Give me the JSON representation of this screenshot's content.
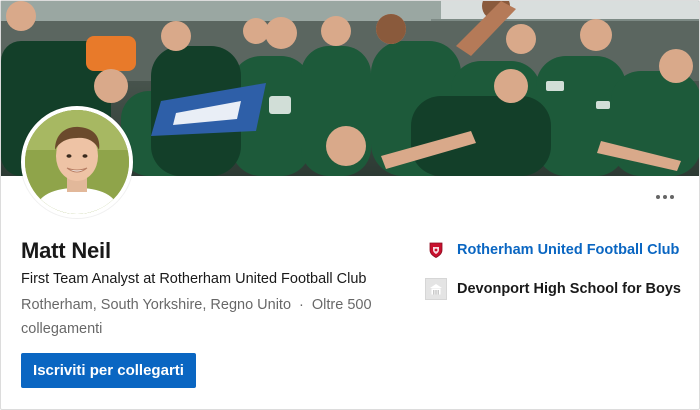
{
  "profile": {
    "name": "Matt Neil",
    "headline": "First Team Analyst at Rotherham United Football Club",
    "location": "Rotherham, South Yorkshire, Regno Unito",
    "separator": "·",
    "connections": "Oltre 500 collegamenti"
  },
  "actions": {
    "connect_label": "Iscriviti per collegarti",
    "more_icon": "ellipsis-icon"
  },
  "experience": {
    "company": "Rotherham United Football Club",
    "company_icon": "club-crest-icon",
    "school": "Devonport High School for Boys",
    "school_icon": "school-building-icon"
  },
  "colors": {
    "accent": "#0a66c2",
    "kit_green": "#1d5a3a",
    "crest_red": "#c8102e"
  }
}
